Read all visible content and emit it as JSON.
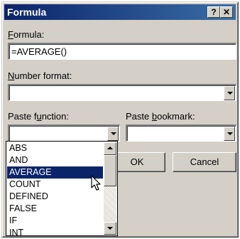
{
  "window": {
    "title": "Formula",
    "help_label": "?",
    "close_label": "✕"
  },
  "formula": {
    "label_key": "F",
    "label_rest": "ormula:",
    "value": "=AVERAGE()"
  },
  "number_format": {
    "label_key": "N",
    "label_rest": "umber format:",
    "value": ""
  },
  "paste_function": {
    "label_pre": "Paste f",
    "label_key": "u",
    "label_post": "nction:",
    "value": "",
    "options": [
      "ABS",
      "AND",
      "AVERAGE",
      "COUNT",
      "DEFINED",
      "FALSE",
      "IF",
      "INT"
    ],
    "selected": "AVERAGE"
  },
  "paste_bookmark": {
    "label_pre": "Paste ",
    "label_key": "b",
    "label_post": "ookmark:",
    "value": ""
  },
  "buttons": {
    "ok": "OK",
    "cancel": "Cancel"
  },
  "icons": {
    "dropdown": "chevron-down-icon",
    "scroll_up": "scroll-up-icon",
    "scroll_down": "scroll-down-icon",
    "pointer": "arrow-cursor-icon"
  },
  "colors": {
    "titlebar": "#0a246a",
    "selection": "#0a246a",
    "face": "#d4d0c8"
  }
}
